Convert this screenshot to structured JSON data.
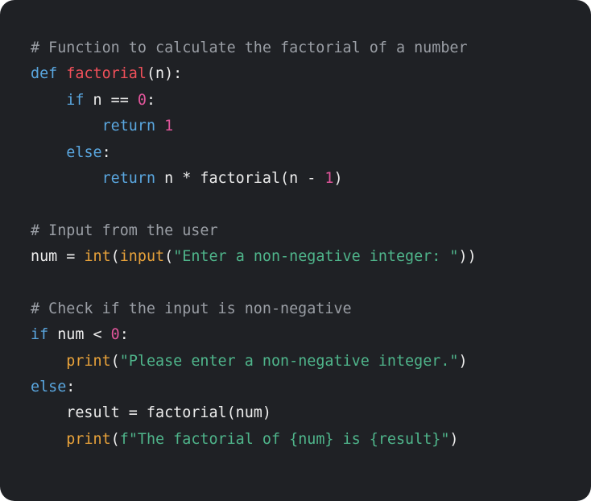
{
  "code_block": {
    "language": "python",
    "colors": {
      "background": "#1f2125",
      "comment": "#9a9ea5",
      "keyword": "#5aa7e0",
      "funcname": "#f0505a",
      "number": "#e0559a",
      "builtin": "#e8a23a",
      "string": "#4fb58b",
      "plain": "#ededed"
    },
    "lines": [
      [
        {
          "t": "comment",
          "v": "# Function to calculate the factorial of a number"
        }
      ],
      [
        {
          "t": "keyword",
          "v": "def"
        },
        {
          "t": "plain",
          "v": " "
        },
        {
          "t": "funcname",
          "v": "factorial"
        },
        {
          "t": "plain",
          "v": "(n):"
        }
      ],
      [
        {
          "t": "plain",
          "v": "    "
        },
        {
          "t": "keyword",
          "v": "if"
        },
        {
          "t": "plain",
          "v": " n == "
        },
        {
          "t": "number",
          "v": "0"
        },
        {
          "t": "plain",
          "v": ":"
        }
      ],
      [
        {
          "t": "plain",
          "v": "        "
        },
        {
          "t": "keyword",
          "v": "return"
        },
        {
          "t": "plain",
          "v": " "
        },
        {
          "t": "number",
          "v": "1"
        }
      ],
      [
        {
          "t": "plain",
          "v": "    "
        },
        {
          "t": "keyword",
          "v": "else"
        },
        {
          "t": "plain",
          "v": ":"
        }
      ],
      [
        {
          "t": "plain",
          "v": "        "
        },
        {
          "t": "keyword",
          "v": "return"
        },
        {
          "t": "plain",
          "v": " n * factorial(n - "
        },
        {
          "t": "number",
          "v": "1"
        },
        {
          "t": "plain",
          "v": ")"
        }
      ],
      [],
      [
        {
          "t": "comment",
          "v": "# Input from the user"
        }
      ],
      [
        {
          "t": "plain",
          "v": "num = "
        },
        {
          "t": "builtin",
          "v": "int"
        },
        {
          "t": "plain",
          "v": "("
        },
        {
          "t": "builtin",
          "v": "input"
        },
        {
          "t": "plain",
          "v": "("
        },
        {
          "t": "string",
          "v": "\"Enter a non-negative integer: \""
        },
        {
          "t": "plain",
          "v": "))"
        }
      ],
      [],
      [
        {
          "t": "comment",
          "v": "# Check if the input is non-negative"
        }
      ],
      [
        {
          "t": "keyword",
          "v": "if"
        },
        {
          "t": "plain",
          "v": " num < "
        },
        {
          "t": "number",
          "v": "0"
        },
        {
          "t": "plain",
          "v": ":"
        }
      ],
      [
        {
          "t": "plain",
          "v": "    "
        },
        {
          "t": "builtin",
          "v": "print"
        },
        {
          "t": "plain",
          "v": "("
        },
        {
          "t": "string",
          "v": "\"Please enter a non-negative integer.\""
        },
        {
          "t": "plain",
          "v": ")"
        }
      ],
      [
        {
          "t": "keyword",
          "v": "else"
        },
        {
          "t": "plain",
          "v": ":"
        }
      ],
      [
        {
          "t": "plain",
          "v": "    result = factorial(num)"
        }
      ],
      [
        {
          "t": "plain",
          "v": "    "
        },
        {
          "t": "builtin",
          "v": "print"
        },
        {
          "t": "plain",
          "v": "("
        },
        {
          "t": "string",
          "v": "f\"The factorial of {num} is {result}\""
        },
        {
          "t": "plain",
          "v": ")"
        }
      ]
    ]
  }
}
